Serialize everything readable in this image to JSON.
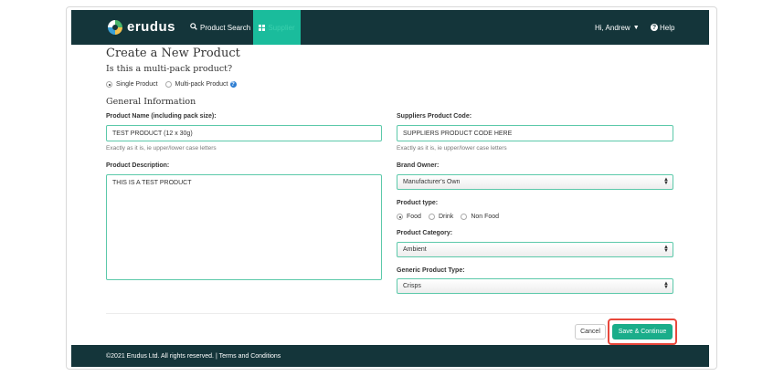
{
  "nav": {
    "brand": "erudus",
    "product_search": "Product Search",
    "supplier": "Supplier",
    "greeting": "Hi, Andrew",
    "help": "Help"
  },
  "form": {
    "title": "Create a New Product",
    "multipack_question": "Is this a multi-pack product?",
    "pack_options": [
      "Single Product",
      "Multi-pack Product"
    ],
    "selected_pack": "Single Product",
    "section_title": "General Information",
    "product_name": {
      "label": "Product Name (including pack size):",
      "value": "TEST PRODUCT (12 x 30g)",
      "help": "Exactly as it is, ie upper/lower case letters"
    },
    "supplier_code": {
      "label": "Suppliers Product Code:",
      "value": "SUPPLIERS PRODUCT CODE HERE",
      "help": "Exactly as it is, ie upper/lower case letters"
    },
    "description": {
      "label": "Product Description:",
      "value": "THIS IS A TEST PRODUCT"
    },
    "brand_owner": {
      "label": "Brand Owner:",
      "value": "Manufacturer's Own"
    },
    "product_type": {
      "label": "Product type:",
      "options": [
        "Food",
        "Drink",
        "Non Food"
      ],
      "selected": "Food"
    },
    "category": {
      "label": "Product Category:",
      "value": "Ambient"
    },
    "generic_type": {
      "label": "Generic Product Type:",
      "value": "Crisps"
    },
    "cancel_label": "Cancel",
    "save_label": "Save & Continue"
  },
  "footer": {
    "text": "©2021 Erudus Ltd. All rights reserved. | Terms and Conditions"
  },
  "colors": {
    "navbar": "#14353a",
    "accent": "#1aad8a",
    "highlight": "#e8473b"
  }
}
